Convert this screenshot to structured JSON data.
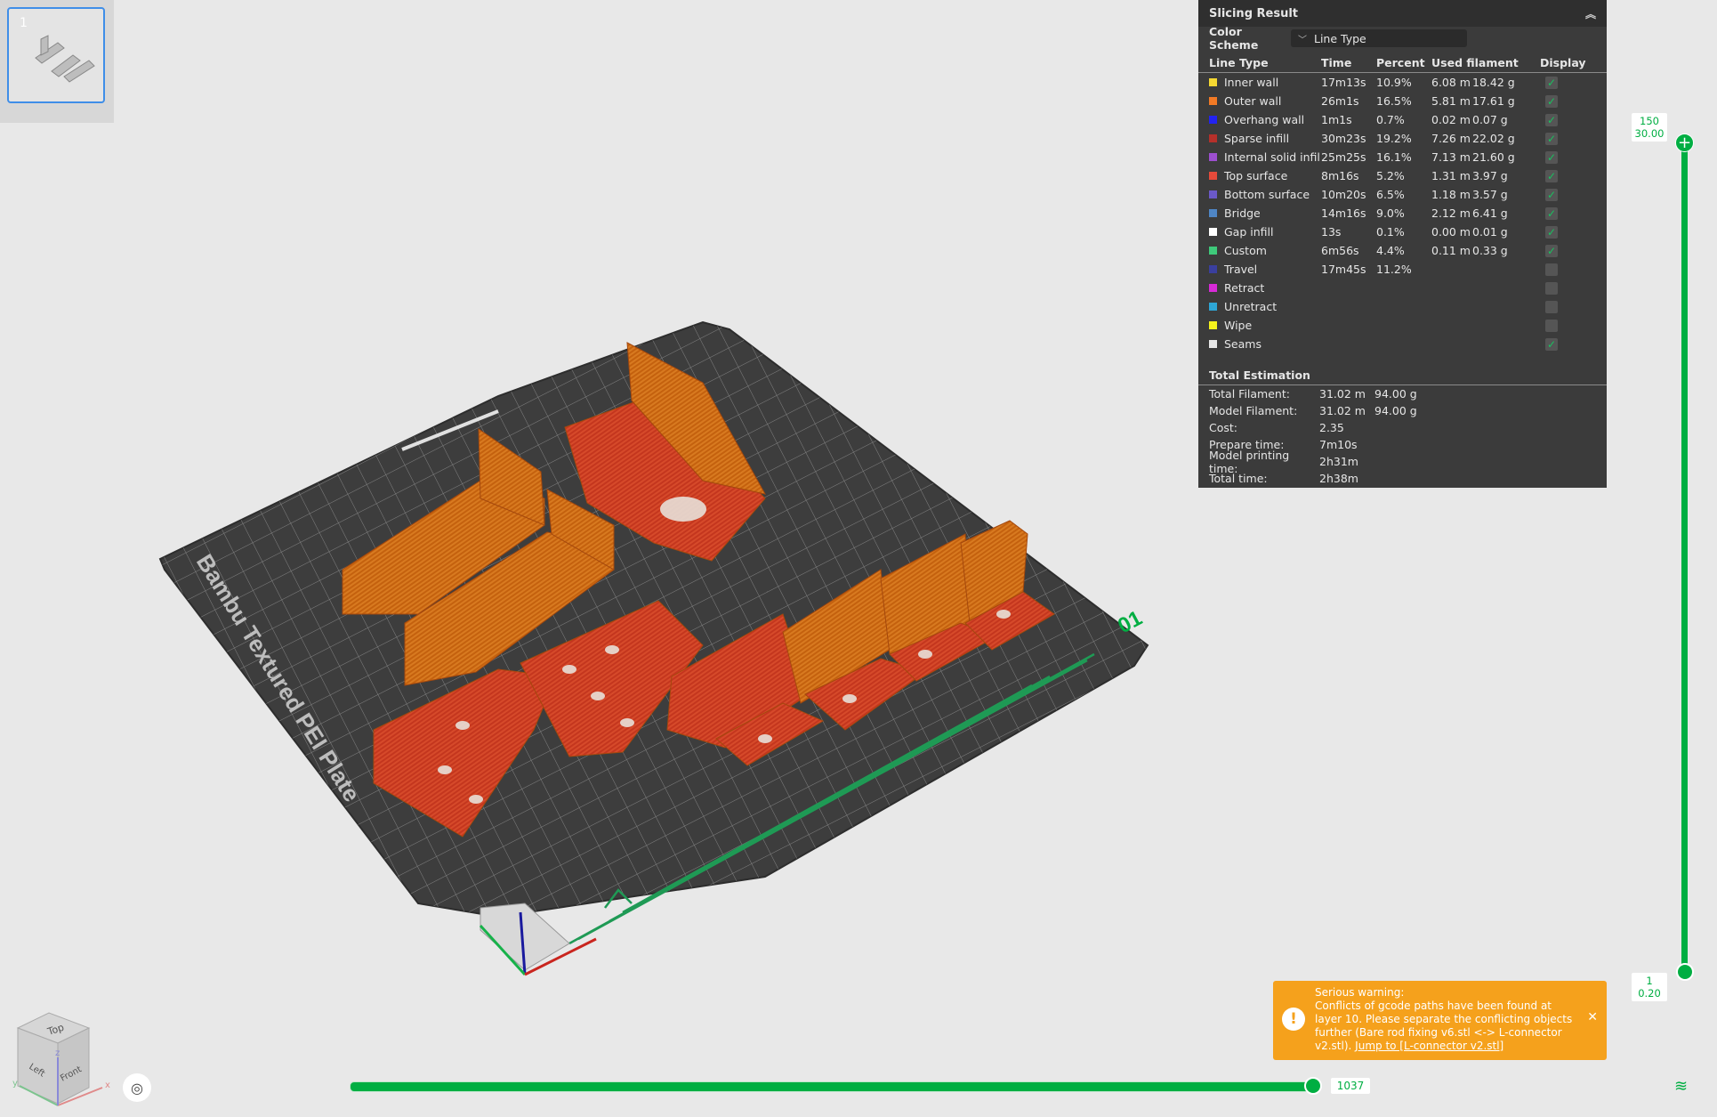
{
  "thumbnail": {
    "plate_number": "1"
  },
  "bed": {
    "label": "Bambu Textured PEI Plate",
    "plate_index": "01"
  },
  "panel": {
    "title": "Slicing Result",
    "color_scheme_label": "Color Scheme",
    "color_scheme_value": "Line Type",
    "headers": {
      "line_type": "Line Type",
      "time": "Time",
      "percent": "Percent",
      "used_filament": "Used filament",
      "display": "Display"
    },
    "rows": [
      {
        "name": "Inner wall",
        "color": "#f5d832",
        "time": "17m13s",
        "percent": "10.9%",
        "meters": "6.08 m",
        "grams": "18.42 g",
        "display": true
      },
      {
        "name": "Outer wall",
        "color": "#f27a25",
        "time": "26m1s",
        "percent": "16.5%",
        "meters": "5.81 m",
        "grams": "17.61 g",
        "display": true
      },
      {
        "name": "Overhang wall",
        "color": "#2323f0",
        "time": "1m1s",
        "percent": "0.7%",
        "meters": "0.02 m",
        "grams": "0.07 g",
        "display": true
      },
      {
        "name": "Sparse infill",
        "color": "#b5302a",
        "time": "30m23s",
        "percent": "19.2%",
        "meters": "7.26 m",
        "grams": "22.02 g",
        "display": true
      },
      {
        "name": "Internal solid infill",
        "color": "#9d4fd0",
        "time": "25m25s",
        "percent": "16.1%",
        "meters": "7.13 m",
        "grams": "21.60 g",
        "display": true
      },
      {
        "name": "Top surface",
        "color": "#e64a3a",
        "time": "8m16s",
        "percent": "5.2%",
        "meters": "1.31 m",
        "grams": "3.97 g",
        "display": true
      },
      {
        "name": "Bottom surface",
        "color": "#6b59c9",
        "time": "10m20s",
        "percent": "6.5%",
        "meters": "1.18 m",
        "grams": "3.57 g",
        "display": true
      },
      {
        "name": "Bridge",
        "color": "#4f86c6",
        "time": "14m16s",
        "percent": "9.0%",
        "meters": "2.12 m",
        "grams": "6.41 g",
        "display": true
      },
      {
        "name": "Gap infill",
        "color": "#ffffff",
        "time": "13s",
        "percent": "0.1%",
        "meters": "0.00 m",
        "grams": "0.01 g",
        "display": true
      },
      {
        "name": "Custom",
        "color": "#3ec97a",
        "time": "6m56s",
        "percent": "4.4%",
        "meters": "0.11 m",
        "grams": "0.33 g",
        "display": true
      },
      {
        "name": "Travel",
        "color": "#3a3f9e",
        "time": "17m45s",
        "percent": "11.2%",
        "meters": "",
        "grams": "",
        "display": false
      },
      {
        "name": "Retract",
        "color": "#d82ad8",
        "time": "",
        "percent": "",
        "meters": "",
        "grams": "",
        "display": false
      },
      {
        "name": "Unretract",
        "color": "#2ea6d6",
        "time": "",
        "percent": "",
        "meters": "",
        "grams": "",
        "display": false
      },
      {
        "name": "Wipe",
        "color": "#f5f21c",
        "time": "",
        "percent": "",
        "meters": "",
        "grams": "",
        "display": false
      },
      {
        "name": "Seams",
        "color": "#e8e8e8",
        "time": "",
        "percent": "",
        "meters": "",
        "grams": "",
        "display": true
      }
    ],
    "total_label": "Total Estimation",
    "totals": [
      {
        "label": "Total Filament:",
        "v1": "31.02 m",
        "v2": "94.00 g"
      },
      {
        "label": "Model Filament:",
        "v1": "31.02 m",
        "v2": "94.00 g"
      },
      {
        "label": "Cost:",
        "v1": "2.35",
        "v2": ""
      },
      {
        "label": "Prepare time:",
        "v1": "7m10s",
        "v2": ""
      },
      {
        "label": "Model printing time:",
        "v1": "2h31m",
        "v2": ""
      },
      {
        "label": "Total time:",
        "v1": "2h38m",
        "v2": ""
      }
    ]
  },
  "layer_slider": {
    "top_layer": "150",
    "top_height": "30.00",
    "bottom_layer": "1",
    "bottom_height": "0.20"
  },
  "move_slider": {
    "value": "1037"
  },
  "warning": {
    "title": "Serious warning:",
    "message": "Conflicts of gcode paths have been found at layer 10. Please separate the conflicting objects further (Bare rod fixing v6.stl <-> L-connector v2.stl).",
    "link": "Jump to [L-connector v2.stl]"
  },
  "view_cube": {
    "top": "Top",
    "left": "Left",
    "front": "Front",
    "x": "x",
    "y": "y",
    "z": "z"
  },
  "icons": {
    "camera": "camera-reset-icon",
    "layers": "layers-icon",
    "warning": "warning-icon",
    "close": "close-icon",
    "collapse": "chevron-up-double-icon"
  }
}
